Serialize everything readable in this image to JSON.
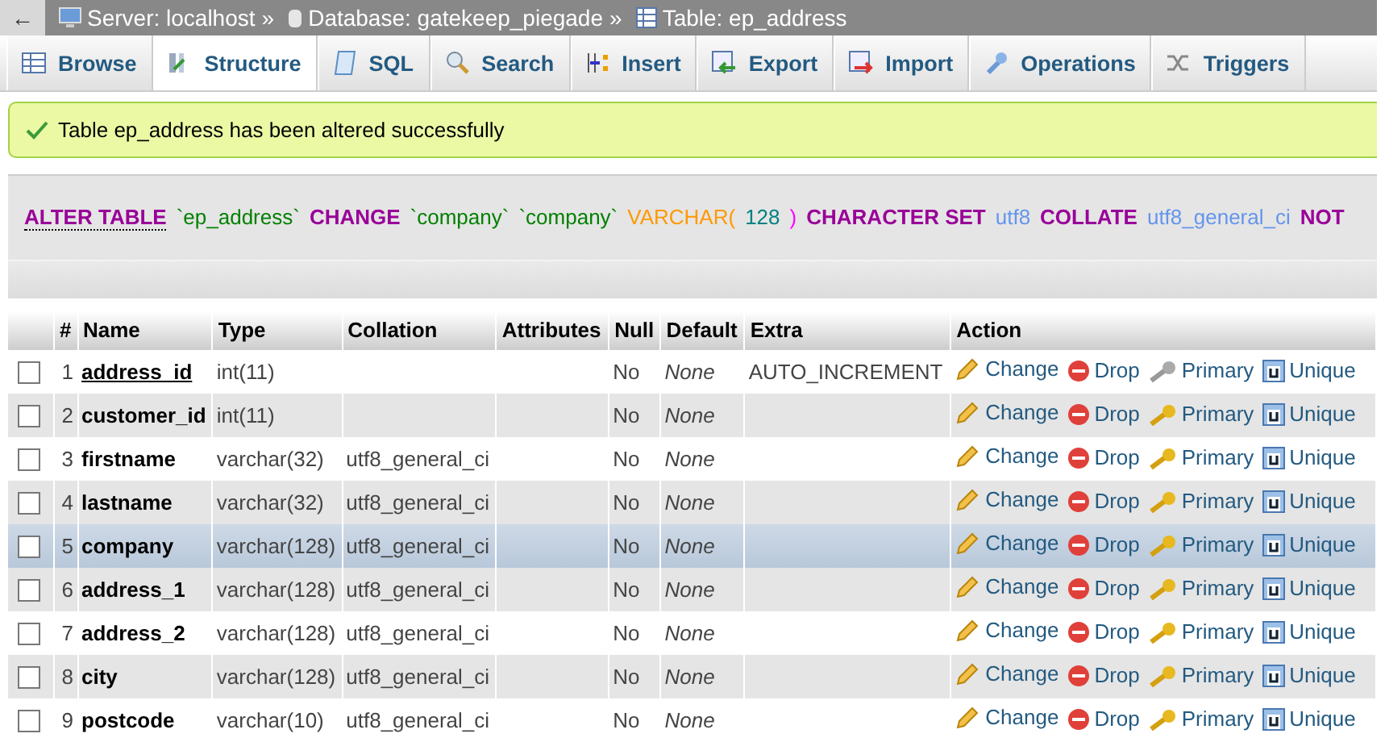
{
  "breadcrumb": {
    "back": "←",
    "items": [
      {
        "kind": "server",
        "label": "Server: localhost"
      },
      {
        "kind": "database",
        "label": "Database: gatekeep_piegade"
      },
      {
        "kind": "table",
        "label": "Table: ep_address"
      }
    ],
    "separator": "»"
  },
  "tabs": [
    {
      "label": "Browse",
      "selected": false
    },
    {
      "label": "Structure",
      "selected": true
    },
    {
      "label": "SQL",
      "selected": false
    },
    {
      "label": "Search",
      "selected": false
    },
    {
      "label": "Insert",
      "selected": false
    },
    {
      "label": "Export",
      "selected": false
    },
    {
      "label": "Import",
      "selected": false
    },
    {
      "label": "Operations",
      "selected": false
    },
    {
      "label": "Triggers",
      "selected": false
    }
  ],
  "message": "Table ep_address has been altered successfully",
  "sql": [
    {
      "kind": "doc_keyword",
      "text": "ALTER TABLE"
    },
    {
      "kind": "identifier",
      "text": "`ep_address`"
    },
    {
      "kind": "keyword",
      "text": "CHANGE"
    },
    {
      "kind": "identifier",
      "text": "`company`"
    },
    {
      "kind": "identifier",
      "text": "`company`"
    },
    {
      "kind": "function",
      "text": "VARCHAR("
    },
    {
      "kind": "number",
      "text": "128"
    },
    {
      "kind": "paren",
      "text": ")"
    },
    {
      "kind": "keyword",
      "text": "CHARACTER SET"
    },
    {
      "kind": "charset",
      "text": "utf8"
    },
    {
      "kind": "keyword",
      "text": "COLLATE"
    },
    {
      "kind": "charset",
      "text": "utf8_general_ci"
    },
    {
      "kind": "keyword",
      "text": "NOT"
    }
  ],
  "table": {
    "columns": [
      "#",
      "Name",
      "Type",
      "Collation",
      "Attributes",
      "Null",
      "Default",
      "Extra",
      "Action"
    ],
    "rows": [
      {
        "num": "1",
        "name": "address_id",
        "type": "int(11)",
        "collation": "",
        "null": "No",
        "default": "None",
        "extra": "AUTO_INCREMENT",
        "checked": false,
        "primary_key": true,
        "highlighted": false,
        "actions": [
          "Change",
          "Drop",
          "Primary",
          "Unique"
        ]
      },
      {
        "num": "2",
        "name": "customer_id",
        "type": "int(11)",
        "collation": "",
        "null": "No",
        "default": "None",
        "extra": "",
        "checked": false,
        "primary_key": false,
        "highlighted": false,
        "actions": [
          "Change",
          "Drop",
          "Primary",
          "Unique"
        ]
      },
      {
        "num": "3",
        "name": "firstname",
        "type": "varchar(32)",
        "collation": "utf8_general_ci",
        "null": "No",
        "default": "None",
        "extra": "",
        "checked": false,
        "primary_key": false,
        "highlighted": false,
        "actions": [
          "Change",
          "Drop",
          "Primary",
          "Unique"
        ]
      },
      {
        "num": "4",
        "name": "lastname",
        "type": "varchar(32)",
        "collation": "utf8_general_ci",
        "null": "No",
        "default": "None",
        "extra": "",
        "checked": false,
        "primary_key": false,
        "highlighted": false,
        "actions": [
          "Change",
          "Drop",
          "Primary",
          "Unique"
        ]
      },
      {
        "num": "5",
        "name": "company",
        "type": "varchar(128)",
        "collation": "utf8_general_ci",
        "null": "No",
        "default": "None",
        "extra": "",
        "checked": false,
        "primary_key": false,
        "highlighted": true,
        "actions": [
          "Change",
          "Drop",
          "Primary",
          "Unique"
        ]
      },
      {
        "num": "6",
        "name": "address_1",
        "type": "varchar(128)",
        "collation": "utf8_general_ci",
        "null": "No",
        "default": "None",
        "extra": "",
        "checked": false,
        "primary_key": false,
        "highlighted": false,
        "actions": [
          "Change",
          "Drop",
          "Primary",
          "Unique"
        ]
      },
      {
        "num": "7",
        "name": "address_2",
        "type": "varchar(128)",
        "collation": "utf8_general_ci",
        "null": "No",
        "default": "None",
        "extra": "",
        "checked": false,
        "primary_key": false,
        "highlighted": false,
        "actions": [
          "Change",
          "Drop",
          "Primary",
          "Unique"
        ]
      },
      {
        "num": "8",
        "name": "city",
        "type": "varchar(128)",
        "collation": "utf8_general_ci",
        "null": "No",
        "default": "None",
        "extra": "",
        "checked": false,
        "primary_key": false,
        "highlighted": false,
        "actions": [
          "Change",
          "Drop",
          "Primary",
          "Unique"
        ]
      },
      {
        "num": "9",
        "name": "postcode",
        "type": "varchar(10)",
        "collation": "utf8_general_ci",
        "null": "No",
        "default": "None",
        "extra": "",
        "checked": false,
        "primary_key": false,
        "highlighted": false,
        "actions": [
          "Change",
          "Drop",
          "Primary",
          "Unique"
        ]
      }
    ]
  }
}
